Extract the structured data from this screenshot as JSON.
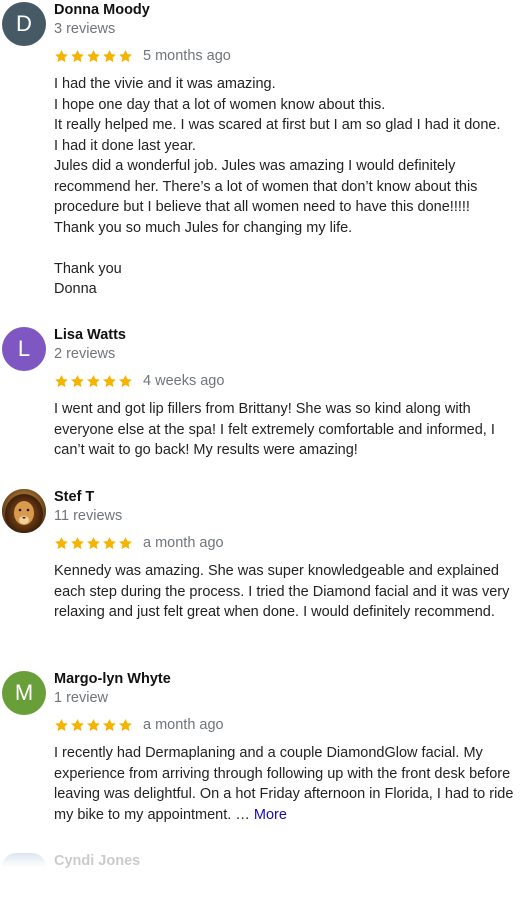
{
  "reviews": [
    {
      "avatar_letter": "D",
      "avatar_color": "#455a64",
      "name": "Donna Moody",
      "review_count": "3 reviews",
      "stars": 5,
      "time": "5 months ago",
      "text": "I had the vivie and it was amazing.\nI hope one day that a lot of women know about this.\nIt really helped me. I was scared at first but I am so glad I had it done.\nI had it done last year.\nJules did a wonderful job. Jules  was amazing I would definitely recommend her. There’s a lot of women that don’t know about this procedure but I believe that all women need to have this done!!!!!\nThank you so much Jules for changing my life.\n\nThank you\nDonna"
    },
    {
      "avatar_letter": "L",
      "avatar_color": "#7e57c2",
      "name": "Lisa Watts",
      "review_count": "2 reviews",
      "stars": 5,
      "time": "4 weeks ago",
      "text": "I went and got lip fillers from Brittany! She was so kind along with everyone else at the spa! I felt extremely comfortable and informed, I can’t wait to go back! My results were amazing!"
    },
    {
      "avatar_icon": "lion-photo-icon",
      "name": "Stef T",
      "review_count": "11 reviews",
      "stars": 5,
      "time": "a month ago",
      "text": "Kennedy was amazing. She was super knowledgeable and explained each step during the process. I tried the Diamond facial and it was very relaxing and just felt great when done. I would definitely recommend."
    },
    {
      "avatar_letter": "M",
      "avatar_color": "#689f38",
      "name": "Margo-lyn Whyte",
      "review_count": "1 review",
      "stars": 5,
      "time": "a month ago",
      "text": "I recently had Dermaplaning and a couple DiamondGlow facial. My experience from arriving through following up with the front desk before leaving was delightful. On a hot Friday afternoon in Florida, I had to ride my bike to my appointment. … ",
      "more_label": "More"
    },
    {
      "name": "Cyndi Jones"
    }
  ],
  "colors": {
    "star": "#f4b400",
    "link": "#1a0dab",
    "secondary_text": "#70757a"
  }
}
